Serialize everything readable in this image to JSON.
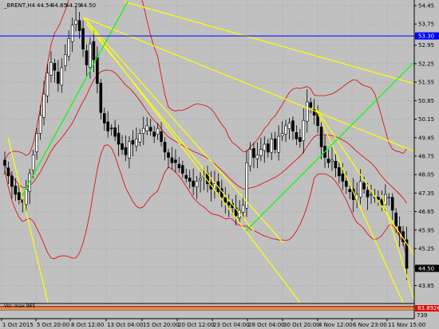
{
  "chart_data": {
    "type": "candlestick",
    "title": "_BRENT,H4",
    "header_values": [
      "44.54",
      "44.65",
      "44.29",
      "44.50"
    ],
    "ylim": [
      43.2,
      54.6
    ],
    "y_ticks": [
      "54.45",
      "53.75",
      "53.30",
      "52.95",
      "52.25",
      "51.55",
      "50.85",
      "50.15",
      "49.45",
      "48.75",
      "48.05",
      "47.35",
      "46.65",
      "45.95",
      "45.25",
      "44.55",
      "43.85"
    ],
    "x_ticks": [
      "1 Oct 2015",
      "5 Oct 20:00",
      "8 Oct 12:00",
      "13 Oct 04:00",
      "15 Oct 20:00",
      "20 Oct 12:00",
      "23 Oct 04:00",
      "28 Oct 04:00",
      "30 Oct 20:00",
      "4 Nov 12:00",
      "6 Nov 23:00",
      "11 Nov 15:00"
    ],
    "hline": {
      "value": 53.3,
      "label": "53.30"
    },
    "current_price": {
      "value": 44.5,
      "label": "44.50"
    },
    "close_prices": [
      48.4,
      48.0,
      47.6,
      47.3,
      47.1,
      47.0,
      47.5,
      48.1,
      48.8,
      49.6,
      50.3,
      51.1,
      51.9,
      52.3,
      52.0,
      51.5,
      52.1,
      52.6,
      53.2,
      53.7,
      53.9,
      53.5,
      52.8,
      52.2,
      53.0,
      52.4,
      51.5,
      50.4,
      50.0,
      49.7,
      49.8,
      49.5,
      49.2,
      49.0,
      48.8,
      49.3,
      49.2,
      49.4,
      49.6,
      49.8,
      49.9,
      49.7,
      49.5,
      49.8,
      49.3,
      48.9,
      48.7,
      48.5,
      48.5,
      48.3,
      48.1,
      47.9,
      47.8,
      47.6,
      47.8,
      47.9,
      48.0,
      47.7,
      47.5,
      47.7,
      47.4,
      47.2,
      47.0,
      46.9,
      46.8,
      46.5,
      46.7,
      46.9,
      48.5,
      49.0,
      48.7,
      48.8,
      49.0,
      49.2,
      48.9,
      49.4,
      49.0,
      49.5,
      49.6,
      49.9,
      50.0,
      49.7,
      49.4,
      49.3,
      50.1,
      50.8,
      50.6,
      50.3,
      49.9,
      49.1,
      48.7,
      48.5,
      48.6,
      48.3,
      48.0,
      47.8,
      47.6,
      47.4,
      47.1,
      47.3,
      47.8,
      47.5,
      47.2,
      47.3,
      47.2,
      47.1,
      46.9,
      47.3,
      47.2,
      46.7,
      46.1,
      45.8,
      45.5,
      44.5
    ],
    "bollinger_color": "#e00000",
    "trendline_yellow": "#ffff00",
    "trendline_green": "#00ff00",
    "hline_color": "#0000ff",
    "up_color": "#ffffff",
    "down_color": "#000000",
    "indicator_label": "Vol: max 965",
    "indicator_value": "83.8926",
    "indicator_bottom": "739"
  }
}
